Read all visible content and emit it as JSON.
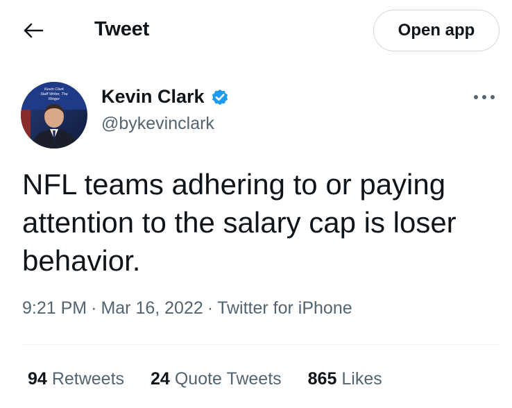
{
  "header": {
    "title": "Tweet",
    "open_app_label": "Open app",
    "back_icon": "arrow-left-icon"
  },
  "author": {
    "name": "Kevin Clark",
    "handle": "@bykevinclark",
    "verified": true,
    "verified_color": "#1d9bf0",
    "avatar_overlay_text": "Kevin Clark Staff Writer, The Ringer"
  },
  "tweet": {
    "text": "NFL teams adhering to or paying attention to the salary cap is loser behavior.",
    "time": "9:21 PM",
    "date": "Mar 16, 2022",
    "source": "Twitter for iPhone",
    "separator": "·"
  },
  "stats": [
    {
      "count": "94",
      "label": "Retweets"
    },
    {
      "count": "24",
      "label": "Quote Tweets"
    },
    {
      "count": "865",
      "label": "Likes"
    }
  ],
  "colors": {
    "text_primary": "#0f1419",
    "text_secondary": "#536471",
    "border": "#cfd9de"
  }
}
